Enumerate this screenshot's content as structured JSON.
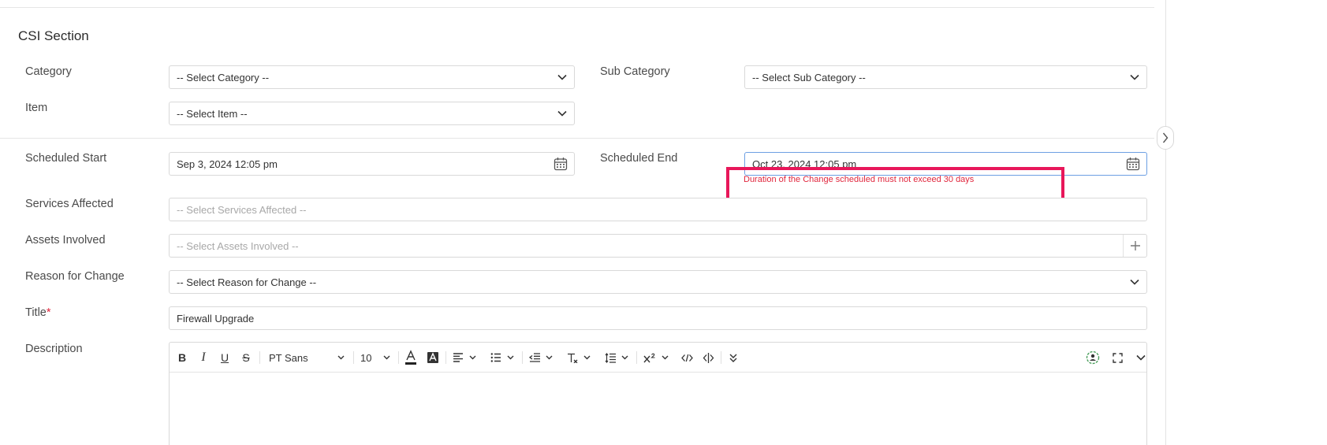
{
  "section": {
    "title": "CSI Section"
  },
  "fields": {
    "category": {
      "label": "Category",
      "value": "-- Select Category --"
    },
    "sub_category": {
      "label": "Sub Category",
      "value": "-- Select Sub Category --"
    },
    "item": {
      "label": "Item",
      "value": "-- Select Item --"
    },
    "scheduled_start": {
      "label": "Scheduled Start",
      "value": "Sep 3, 2024 12:05 pm"
    },
    "scheduled_end": {
      "label": "Scheduled End",
      "value": "Oct 23, 2024 12:05 pm",
      "error": "Duration of the Change scheduled must not exceed 30 days"
    },
    "services_affected": {
      "label": "Services Affected",
      "placeholder": "-- Select Services Affected --"
    },
    "assets_involved": {
      "label": "Assets Involved",
      "placeholder": "-- Select Assets Involved --"
    },
    "reason_for_change": {
      "label": "Reason for Change",
      "value": "-- Select Reason for Change --"
    },
    "title": {
      "label": "Title",
      "required_mark": "*",
      "value": "Firewall Upgrade"
    },
    "description": {
      "label": "Description"
    }
  },
  "editor_toolbar": {
    "font_family": "PT Sans",
    "font_size": "10"
  },
  "colors": {
    "error": "#e0263d",
    "highlight": "#e8175a",
    "focus_border": "#6d9fe3"
  }
}
